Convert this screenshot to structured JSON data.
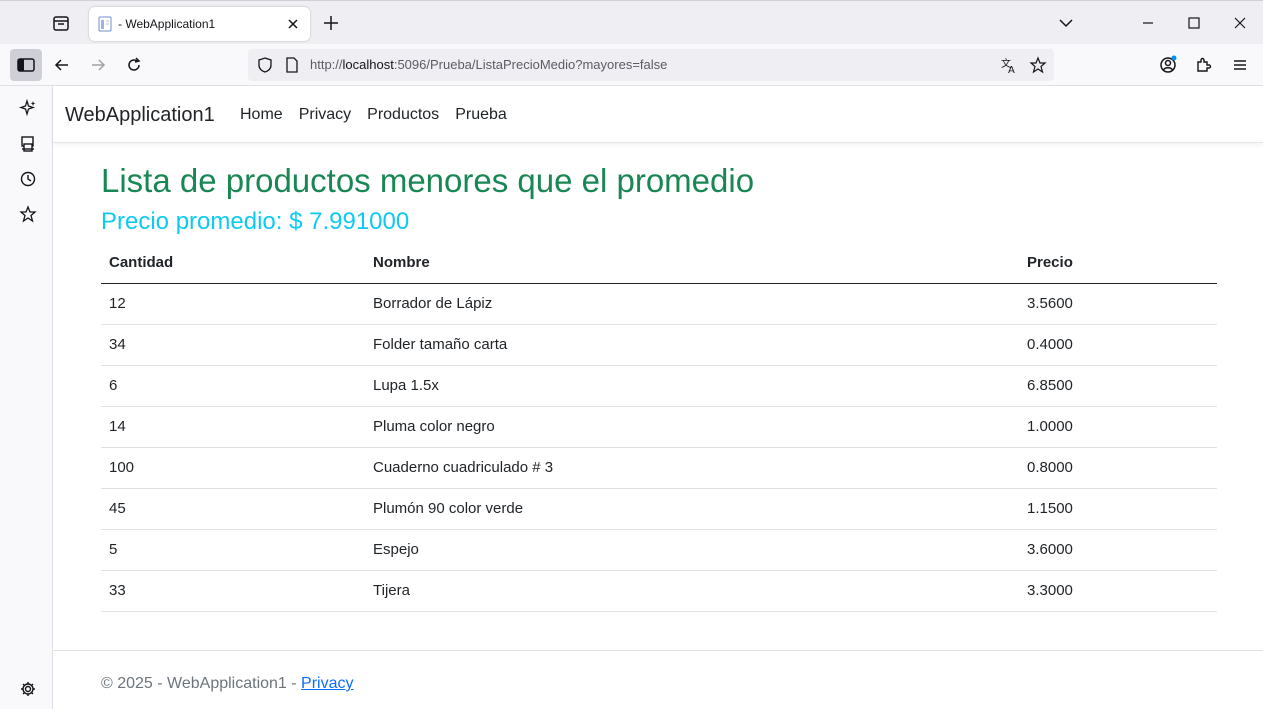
{
  "browser": {
    "tab_title": "- WebApplication1",
    "url_prefix": "http://",
    "url_host": "localhost",
    "url_rest": ":5096/Prueba/ListaPrecioMedio?mayores=false"
  },
  "site": {
    "brand": "WebApplication1",
    "nav": [
      "Home",
      "Privacy",
      "Productos",
      "Prueba"
    ]
  },
  "main": {
    "title": "Lista de productos menores que el promedio",
    "subtitle": "Precio promedio: $ 7.991000",
    "columns": [
      "Cantidad",
      "Nombre",
      "Precio"
    ],
    "rows": [
      [
        "12",
        "Borrador de Lápiz",
        "3.5600"
      ],
      [
        "34",
        "Folder tamaño carta",
        "0.4000"
      ],
      [
        "6",
        "Lupa 1.5x",
        "6.8500"
      ],
      [
        "14",
        "Pluma color negro",
        "1.0000"
      ],
      [
        "100",
        "Cuaderno cuadriculado # 3",
        "0.8000"
      ],
      [
        "45",
        "Plumón 90 color verde",
        "1.1500"
      ],
      [
        "5",
        "Espejo",
        "3.6000"
      ],
      [
        "33",
        "Tijera",
        "3.3000"
      ]
    ]
  },
  "footer": {
    "text": "© 2025 - WebApplication1 - ",
    "link": "Privacy"
  }
}
